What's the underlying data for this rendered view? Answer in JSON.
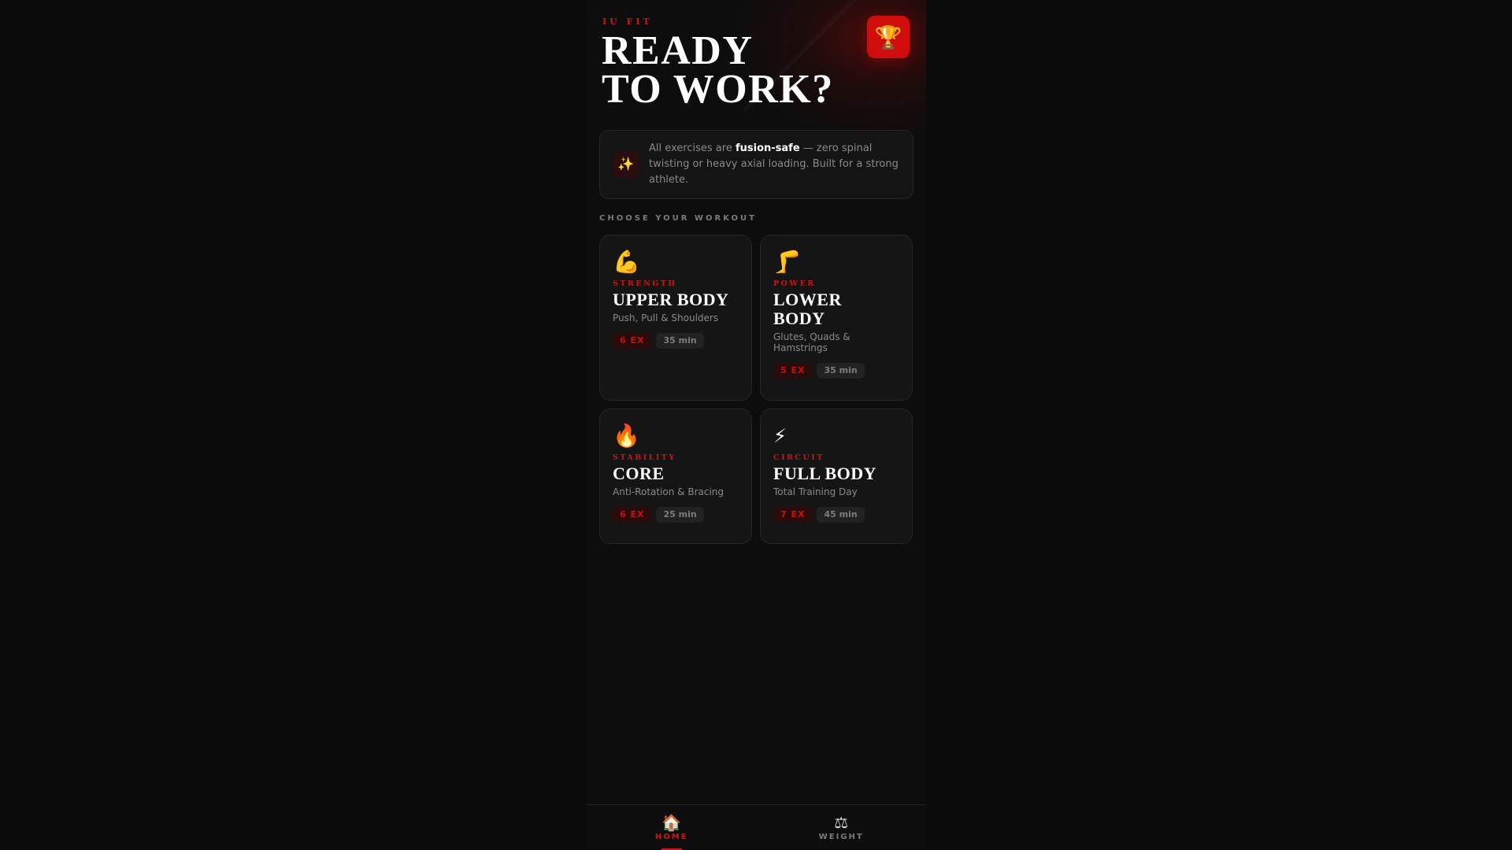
{
  "header": {
    "brand": "IU FIT",
    "headline_line1": "READY",
    "headline_line2": "TO WORK?",
    "trophy_icon": "trophy-icon"
  },
  "notice": {
    "icon": "sparkles-icon",
    "text_before": "All exercises are ",
    "text_bold": "fusion-safe",
    "text_after": " — zero spinal twisting or heavy axial loading. Built for a strong athlete."
  },
  "section_label": "CHOOSE YOUR WORKOUT",
  "workouts": [
    {
      "emoji": "💪",
      "category": "STRENGTH",
      "title": "UPPER BODY",
      "subtitle": "Push, Pull & Shoulders",
      "exercises": "6 EX",
      "duration": "35 min"
    },
    {
      "emoji": "🦵",
      "category": "POWER",
      "title": "LOWER BODY",
      "subtitle": "Glutes, Quads & Hamstrings",
      "exercises": "5 EX",
      "duration": "35 min"
    },
    {
      "emoji": "🔥",
      "category": "STABILITY",
      "title": "CORE",
      "subtitle": "Anti-Rotation & Bracing",
      "exercises": "6 EX",
      "duration": "25 min"
    },
    {
      "emoji": "⚡",
      "category": "CIRCUIT",
      "title": "FULL BODY",
      "subtitle": "Total Training Day",
      "exercises": "7 EX",
      "duration": "45 min"
    }
  ],
  "nav": [
    {
      "icon": "🏠",
      "label": "HOME",
      "active": true
    },
    {
      "icon": "⚖",
      "label": "WEIGHT",
      "active": false
    }
  ],
  "colors": {
    "accent": "#cc1414",
    "background": "#0d0d0d",
    "card": "#151515"
  }
}
